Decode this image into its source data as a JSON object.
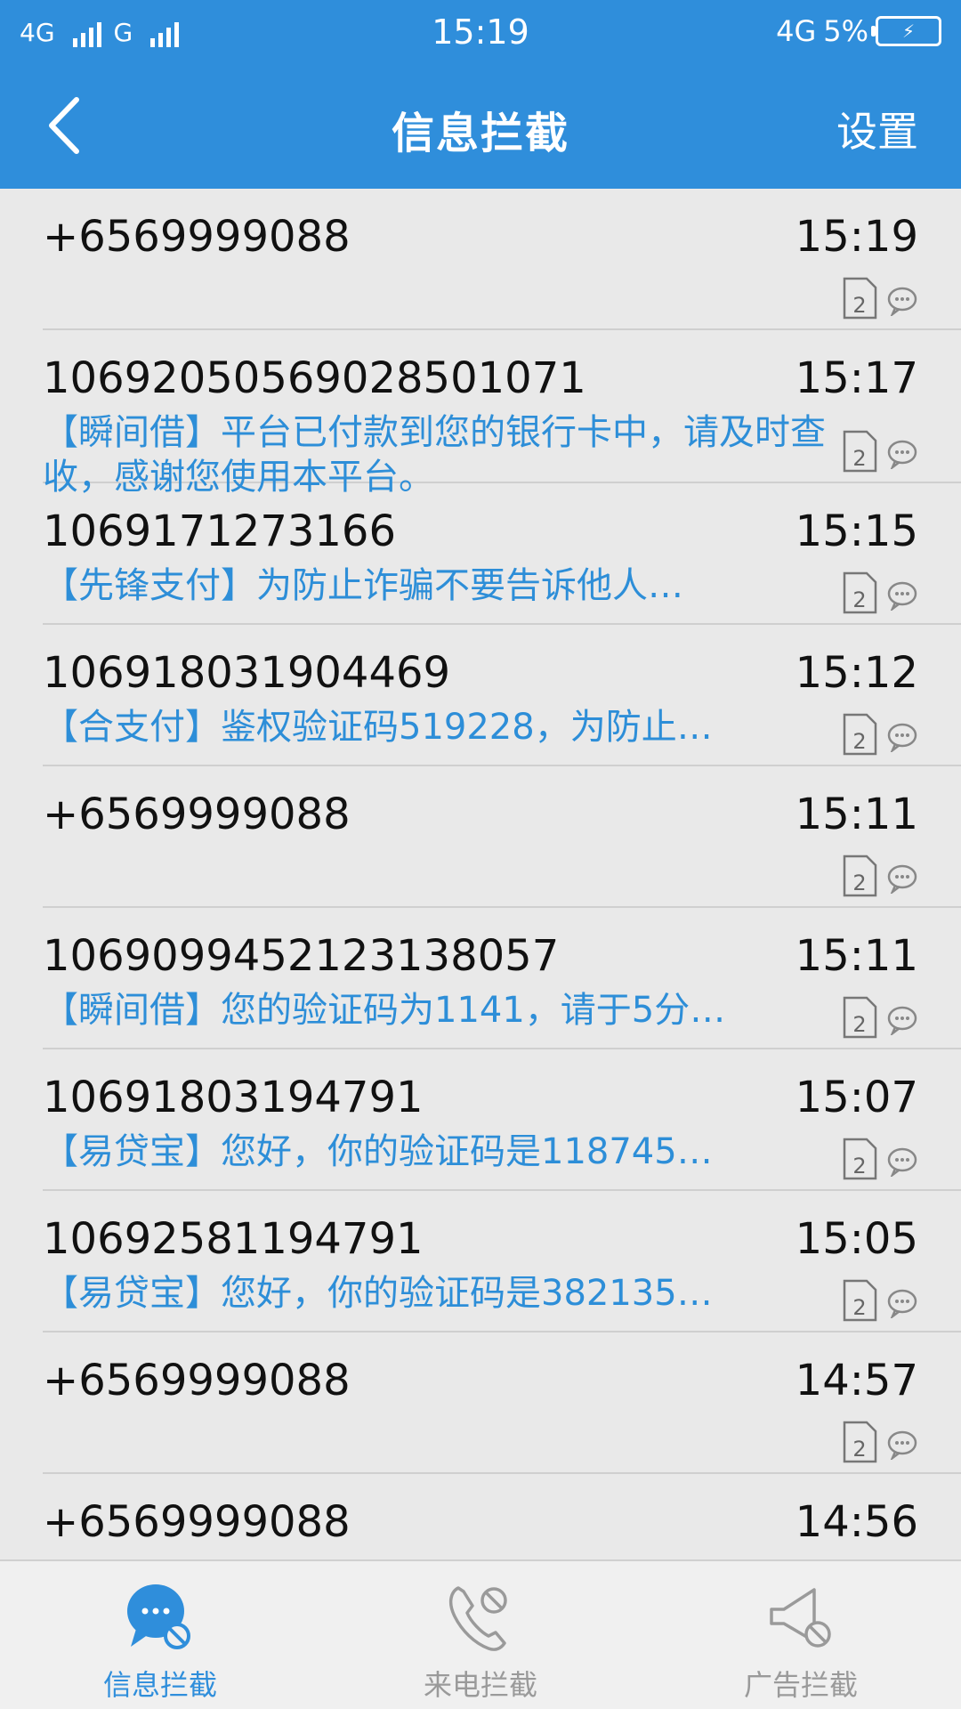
{
  "status_bar": {
    "network1": "4G",
    "network2": "G",
    "time": "15:19",
    "network3": "4G",
    "battery_percent": "5%"
  },
  "header": {
    "title": "信息拦截",
    "settings_label": "设置"
  },
  "messages": [
    {
      "number": "+6569999088",
      "time": "15:19",
      "preview": ""
    },
    {
      "number": "1069205056902850​1071",
      "time": "15:17",
      "preview": "【瞬间借】平台已付款到您的银行卡中，请及时查收，感谢您使用本平台。"
    },
    {
      "number": "1069171273166",
      "time": "15:15",
      "preview": "【先锋支付】为防止诈骗不要告诉他人…"
    },
    {
      "number": "106918031904469",
      "time": "15:12",
      "preview": "【合支付】鉴权验证码519228，为防止…"
    },
    {
      "number": "+6569999088",
      "time": "15:11",
      "preview": ""
    },
    {
      "number": "106909945212313​8057",
      "time": "15:11",
      "preview": "【瞬间借】您的验证码为1141，请于5分…"
    },
    {
      "number": "10691803194791",
      "time": "15:07",
      "preview": "【易贷宝】您好，你的验证码是118745…"
    },
    {
      "number": "10692581194791",
      "time": "15:05",
      "preview": "【易贷宝】您好，你的验证码是382135…"
    },
    {
      "number": "+6569999088",
      "time": "14:57",
      "preview": ""
    },
    {
      "number": "+6569999088",
      "time": "14:56",
      "preview": ""
    }
  ],
  "sim_slot": "2",
  "bottom_nav": [
    {
      "label": "信息拦截",
      "active": true
    },
    {
      "label": "来电拦截",
      "active": false
    },
    {
      "label": "广告拦截",
      "active": false
    }
  ],
  "colors": {
    "accent": "#2f8edb",
    "preview_text": "#2d8ed8",
    "inactive": "#9a9a9a"
  }
}
